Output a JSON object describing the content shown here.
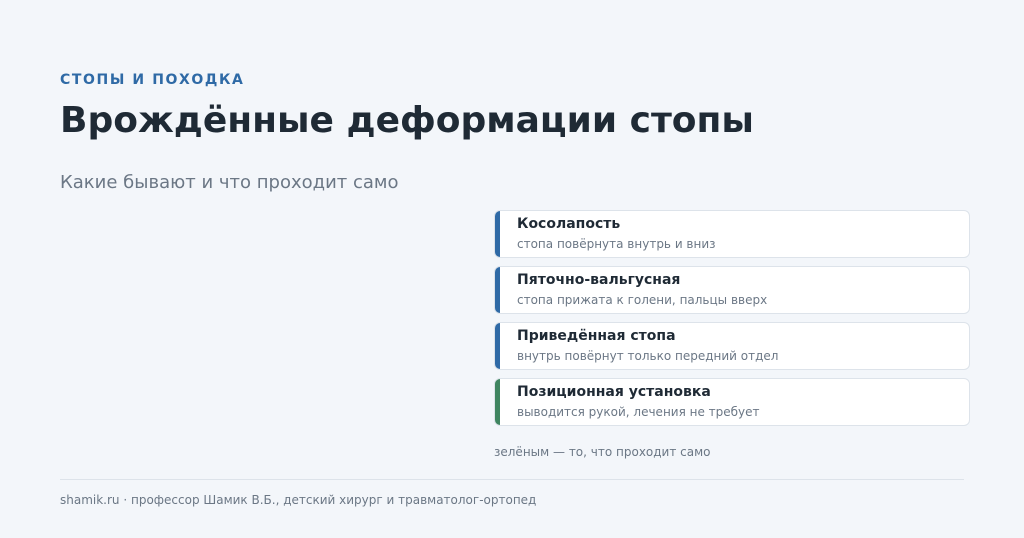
{
  "header": {
    "eyebrow": "СТОПЫ И ПОХОДКА",
    "title": "Врождённые деформации стопы",
    "subtitle": "Какие бывают и что проходит само"
  },
  "colors": {
    "accent_blue": "#2f6aa6",
    "accent_green": "#3f8560"
  },
  "cards": [
    {
      "title": "Косолапость",
      "desc": "стопа повёрнута внутрь и вниз",
      "marker": "blue"
    },
    {
      "title": "Пяточно-вальгусная",
      "desc": "стопа прижата к голени, пальцы вверх",
      "marker": "blue"
    },
    {
      "title": "Приведённая стопа",
      "desc": "внутрь повёрнут только передний отдел",
      "marker": "blue"
    },
    {
      "title": "Позиционная установка",
      "desc": "выводится рукой, лечения не требует",
      "marker": "green"
    }
  ],
  "note": "зелёным — то, что проходит само",
  "footer": "shamik.ru · профессор Шамик В.Б., детский хирург и травматолог-ортопед"
}
